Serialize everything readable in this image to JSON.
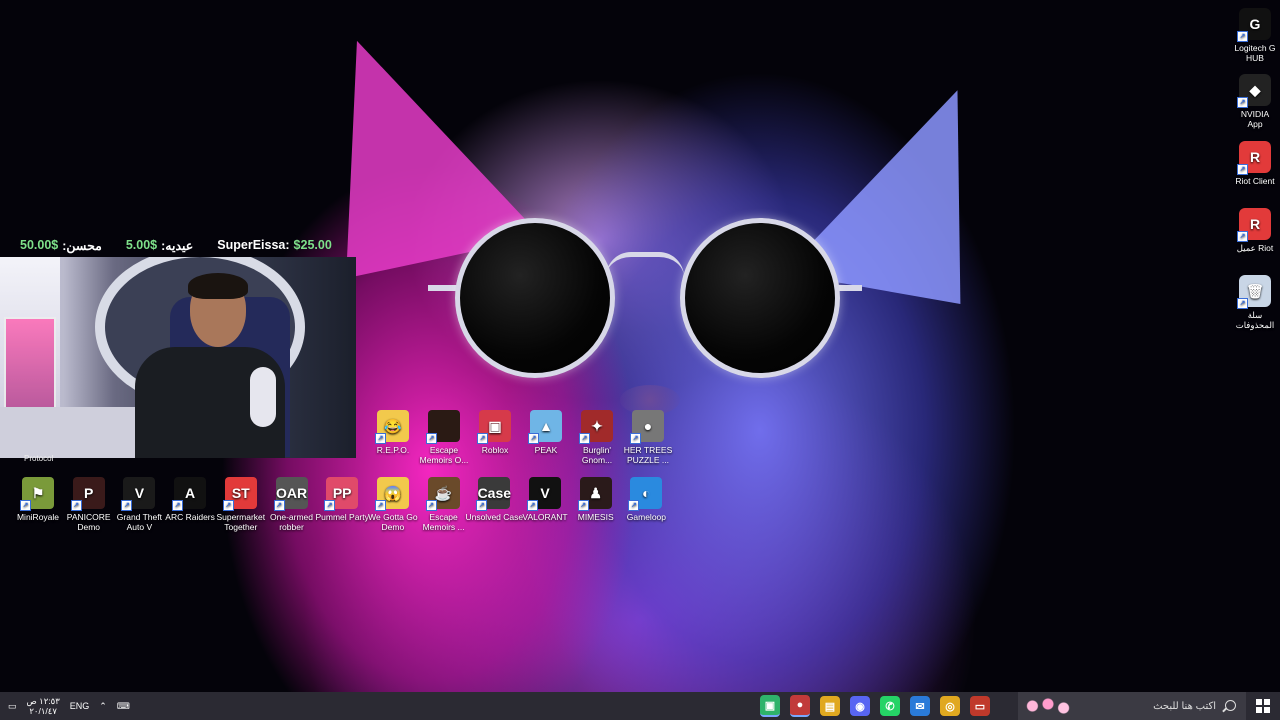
{
  "donations": [
    {
      "amount": "50.00$",
      "name": ":محسن"
    },
    {
      "amount": "5.00$",
      "name": ":عيديه"
    },
    {
      "name": "SuperEissa:",
      "amount": "$25.00"
    }
  ],
  "webcam_label": "Protocol",
  "desktop": {
    "row1": [
      {
        "label": "R.E.P.O.",
        "icon": "repo-icon",
        "color": "#f2c94c",
        "glyph": "😂"
      },
      {
        "label": "Escape Memoirs O...",
        "icon": "escape-memoirs-icon",
        "color": "#2a1a14",
        "glyph": ""
      },
      {
        "label": "Roblox",
        "icon": "roblox-icon",
        "color": "#d63a4a",
        "glyph": "▣"
      },
      {
        "label": "PEAK",
        "icon": "peak-icon",
        "color": "#6fb5e6",
        "glyph": "▲"
      },
      {
        "label": "Burglin' Gnom...",
        "icon": "burglin-gnomes-icon",
        "color": "#a12a2a",
        "glyph": "✦"
      },
      {
        "label": "HER TREES PUZZLE ...",
        "icon": "her-trees-puzzle-icon",
        "color": "#777",
        "glyph": "●"
      }
    ],
    "row2": [
      {
        "label": "MiniRoyale",
        "icon": "miniroyale-icon",
        "color": "#7a9a3a",
        "glyph": "⚑"
      },
      {
        "label": "PANICORE Demo",
        "icon": "panicore-icon",
        "color": "#3a1a1a",
        "glyph": "P"
      },
      {
        "label": "Grand Theft Auto V",
        "icon": "gta-v-icon",
        "color": "#1a1a1a",
        "glyph": "V"
      },
      {
        "label": "ARC Raiders",
        "icon": "arc-raiders-icon",
        "color": "#111",
        "glyph": "A"
      },
      {
        "label": "Supermarket Together",
        "icon": "supermarket-together-icon",
        "color": "#e23a3a",
        "glyph": "ST"
      },
      {
        "label": "One-armed robber",
        "icon": "one-armed-robber-icon",
        "color": "#555",
        "glyph": "OAR"
      },
      {
        "label": "Pummel Party",
        "icon": "pummel-party-icon",
        "color": "#e04a6a",
        "glyph": "PP"
      },
      {
        "label": "We Gotta Go Demo",
        "icon": "we-gotta-go-icon",
        "color": "#f2c94c",
        "glyph": "😱"
      },
      {
        "label": "Escape Memoirs ...",
        "icon": "escape-memoirs-2-icon",
        "color": "#6a4a2a",
        "glyph": "☕"
      },
      {
        "label": "Unsolved Case",
        "icon": "unsolved-case-icon",
        "color": "#3a3a3a",
        "glyph": "Case"
      },
      {
        "label": "VALORANT",
        "icon": "valorant-icon",
        "color": "#111",
        "glyph": "V"
      },
      {
        "label": "MIMESIS",
        "icon": "mimesis-icon",
        "color": "#2a1a1a",
        "glyph": "♟"
      },
      {
        "label": "Gameloop",
        "icon": "gameloop-icon",
        "color": "#2a8adf",
        "glyph": "◐"
      }
    ],
    "right": [
      {
        "label": "Logitech G HUB",
        "icon": "logitech-g-hub-icon",
        "color": "#111",
        "glyph": "G"
      },
      {
        "label": "NVIDIA App",
        "icon": "nvidia-app-icon",
        "color": "#222",
        "glyph": "◆"
      },
      {
        "label": "Riot Client",
        "icon": "riot-client-icon",
        "color": "#e23a3a",
        "glyph": "R"
      },
      {
        "label": "عميل Riot",
        "icon": "riot-client-ar-icon",
        "color": "#e23a3a",
        "glyph": "R"
      },
      {
        "label": "سلة المحذوفات",
        "icon": "recycle-bin-icon",
        "color": "#c9d6e6",
        "glyph": "🗑"
      }
    ]
  },
  "taskbar": {
    "time": "١٢:٥٣ ص",
    "date": "٢٠/١/٤٧",
    "language": "ENG",
    "search_placeholder": "اكتب هنا للبحث",
    "apps": [
      {
        "icon": "app-green-icon",
        "color": "#2fb36b",
        "glyph": "▣",
        "active": true
      },
      {
        "icon": "app-red-icon",
        "color": "#c13a3a",
        "glyph": "●",
        "active": true
      },
      {
        "icon": "app-yellow-icon",
        "color": "#e0a820",
        "glyph": "▤",
        "active": false
      },
      {
        "icon": "discord-icon",
        "color": "#5865f2",
        "glyph": "◉",
        "active": false
      },
      {
        "icon": "whatsapp-icon",
        "color": "#25d366",
        "glyph": "✆",
        "active": false
      },
      {
        "icon": "outlook-icon",
        "color": "#2a7ad8",
        "glyph": "✉",
        "active": false
      },
      {
        "icon": "chrome-icon",
        "color": "#e0a820",
        "glyph": "◎",
        "active": false
      },
      {
        "icon": "app-badge-icon",
        "color": "#c0392b",
        "glyph": "▭",
        "active": false
      }
    ]
  }
}
